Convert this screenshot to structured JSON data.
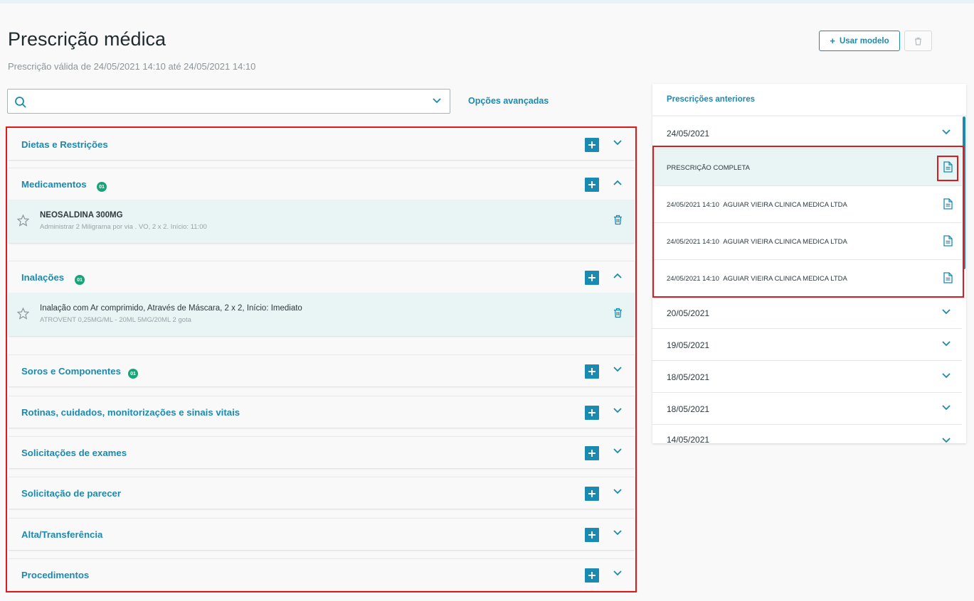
{
  "header": {
    "title": "Prescrição médica",
    "subtitle": "Prescrição válida de 24/05/2021 14:10 até 24/05/2021 14:10",
    "use_model_label": "Usar modelo"
  },
  "search": {
    "value": "",
    "placeholder": "",
    "advanced_options_label": "Opções avançadas"
  },
  "sections": [
    {
      "title": "Dietas e Restrições",
      "badge": "",
      "expanded": false
    },
    {
      "title": "Medicamentos",
      "badge": "01",
      "expanded": true,
      "item": {
        "title": "NEOSALDINA 300MG",
        "detail": "Administrar 2 Miligrama por via . VO, 2 x 2. Início: 11:00"
      }
    },
    {
      "title": "Inalações",
      "badge": "01",
      "expanded": true,
      "item": {
        "title": "Inalação com Ar comprimido, Através de Máscara, 2 x 2, Início: Imediato",
        "detail": "ATROVENT 0,25MG/ML - 20ML 5MG/20ML 2 gota"
      }
    },
    {
      "title": "Soros e Componentes",
      "badge": "01",
      "expanded": false
    },
    {
      "title": "Rotinas, cuidados, monitorizações e sinais vitais",
      "badge": "",
      "expanded": false
    },
    {
      "title": "Solicitações de exames",
      "badge": "",
      "expanded": false
    },
    {
      "title": "Solicitação de parecer",
      "badge": "",
      "expanded": false
    },
    {
      "title": "Alta/Transferência",
      "badge": "",
      "expanded": false
    },
    {
      "title": "Procedimentos",
      "badge": "",
      "expanded": false
    }
  ],
  "previous": {
    "title": "Prescrições anteriores",
    "dates": [
      "24/05/2021",
      "20/05/2021",
      "19/05/2021",
      "18/05/2021",
      "18/05/2021",
      "14/05/2021"
    ],
    "complete_label": "PRESCRIÇÃO COMPLETA",
    "entries": [
      {
        "datetime": "24/05/2021 14:10",
        "clinic": "AGUIAR VIEIRA CLINICA MEDICA LTDA"
      },
      {
        "datetime": "24/05/2021 14:10",
        "clinic": "AGUIAR VIEIRA CLINICA MEDICA LTDA"
      },
      {
        "datetime": "24/05/2021 14:10",
        "clinic": "AGUIAR VIEIRA CLINICA MEDICA LTDA"
      }
    ]
  },
  "colors": {
    "accent": "#1a8ab0",
    "badge": "#1aa378",
    "highlight": "#e0191e",
    "item_bg": "#e9f4f5"
  },
  "icons": [
    "search-icon",
    "chevron-down-icon",
    "chevron-up-icon",
    "plus-icon",
    "star-icon",
    "trash-icon",
    "document-icon"
  ]
}
